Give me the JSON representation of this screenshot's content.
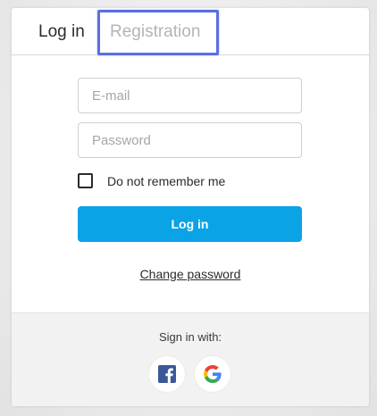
{
  "tabs": {
    "login_label": "Log in",
    "register_label": "Registration"
  },
  "form": {
    "email_placeholder": "E-mail",
    "password_placeholder": "Password",
    "remember_label": "Do not remember me",
    "remember_checked": false,
    "submit_label": "Log in",
    "change_password_label": "Change password"
  },
  "social": {
    "label": "Sign in with:",
    "providers": [
      {
        "name": "facebook",
        "icon": "facebook-icon",
        "color": "#3b5998"
      },
      {
        "name": "google",
        "icon": "google-icon",
        "color": "#4285f4"
      }
    ]
  },
  "colors": {
    "accent": "#0aa3e6",
    "tab_highlight": "#5b6ee1",
    "inactive_tab": "#b4b4b4"
  }
}
